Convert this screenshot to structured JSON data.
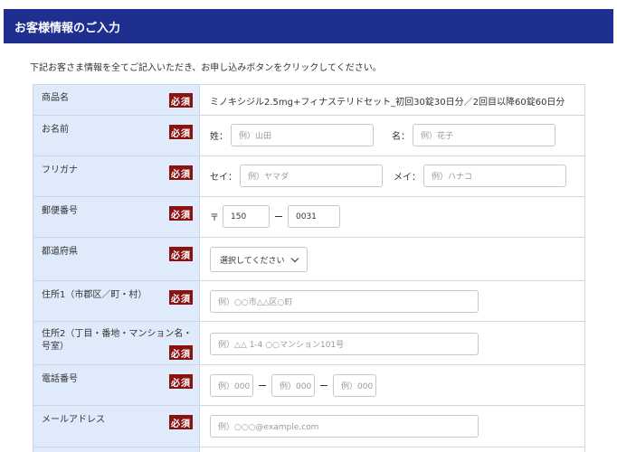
{
  "header": {
    "title": "お客様情報のご入力"
  },
  "intro": "下記お客さま情報を全てご記入いただき、お申し込みボタンをクリックしてください。",
  "required_badge": "必須",
  "rows": {
    "product": {
      "label": "商品名",
      "value": "ミノキシジル2.5mg+フィナステリドセット_初回30錠30日分／2回目以降60錠60日分"
    },
    "name": {
      "label": "お名前",
      "last_label": "姓：",
      "last_placeholder": "例）山田",
      "first_label": "名：",
      "first_placeholder": "例）花子"
    },
    "kana": {
      "label": "フリガナ",
      "last_label": "セイ：",
      "last_placeholder": "例）ヤマダ",
      "first_label": "メイ：",
      "first_placeholder": "例）ハナコ"
    },
    "postal": {
      "label": "郵便番号",
      "mark": "〒",
      "part1": "150",
      "part2": "0031"
    },
    "prefecture": {
      "label": "都道府県",
      "selected": "選択してください"
    },
    "address1": {
      "label": "住所1（市郡区／町・村）",
      "placeholder": "例）○○市△△区○町"
    },
    "address2": {
      "label_line1": "住所2（丁目・番地・マンション名・",
      "label_line2": "号室）",
      "placeholder": "例）△△ 1-4 ○○マンション101号"
    },
    "phone": {
      "label": "電話番号",
      "p1": "例）000",
      "p2": "例）000",
      "p3": "例）000"
    },
    "email": {
      "label": "メールアドレス",
      "placeholder": "例）○○○@example.com"
    }
  }
}
